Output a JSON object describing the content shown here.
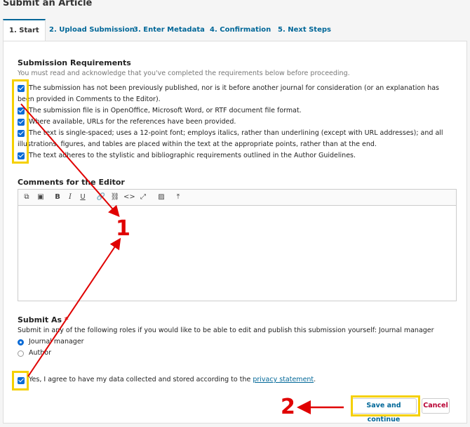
{
  "page": {
    "title": "Submit an Article"
  },
  "tabs": [
    {
      "label": "1. Start"
    },
    {
      "label": "2. Upload Submission"
    },
    {
      "label": "3. Enter Metadata"
    },
    {
      "label": "4. Confirmation"
    },
    {
      "label": "5. Next Steps"
    }
  ],
  "requirements": {
    "heading": "Submission Requirements",
    "intro": "You must read and acknowledge that you've completed the requirements below before proceeding.",
    "items": [
      {
        "text": "The submission has not been previously published, nor is it before another journal for consideration (or an explanation has been provided in Comments to the Editor).",
        "checked": true
      },
      {
        "text": "The submission file is in OpenOffice, Microsoft Word, or RTF document file format.",
        "checked": true
      },
      {
        "text": "Where available, URLs for the references have been provided.",
        "checked": true
      },
      {
        "text": "The text is single-spaced; uses a 12-point font; employs italics, rather than underlining (except with URL addresses); and all illustrations, figures, and tables are placed within the text at the appropriate points, rather than at the end.",
        "checked": true
      },
      {
        "text": "The text adheres to the stylistic and bibliographic requirements outlined in the Author Guidelines.",
        "checked": true
      }
    ]
  },
  "comments": {
    "heading": "Comments for the Editor",
    "toolbar": [
      "copy-icon",
      "paste-icon",
      "bold-icon",
      "italic-icon",
      "underline-icon",
      "link-icon",
      "unlink-icon",
      "code-icon",
      "fullscreen-icon",
      "image-icon",
      "upload-icon"
    ],
    "value": ""
  },
  "submit_as": {
    "heading": "Submit As",
    "required_mark": "*",
    "description": "Submit in any of the following roles if you would like to be able to edit and publish this submission yourself: Journal manager",
    "options": [
      {
        "label": "Journal manager",
        "selected": true
      },
      {
        "label": "Author",
        "selected": false
      }
    ]
  },
  "privacy": {
    "checked": true,
    "text_before": "Yes, I agree to have my data collected and stored according to the ",
    "link_text": "privacy statement",
    "text_after": "."
  },
  "actions": {
    "save_label": "Save and continue",
    "cancel_label": "Cancel"
  },
  "annotations": {
    "step1": "1",
    "step2": "2",
    "highlight_color": "#f5d000",
    "arrow_color": "#e00000"
  }
}
